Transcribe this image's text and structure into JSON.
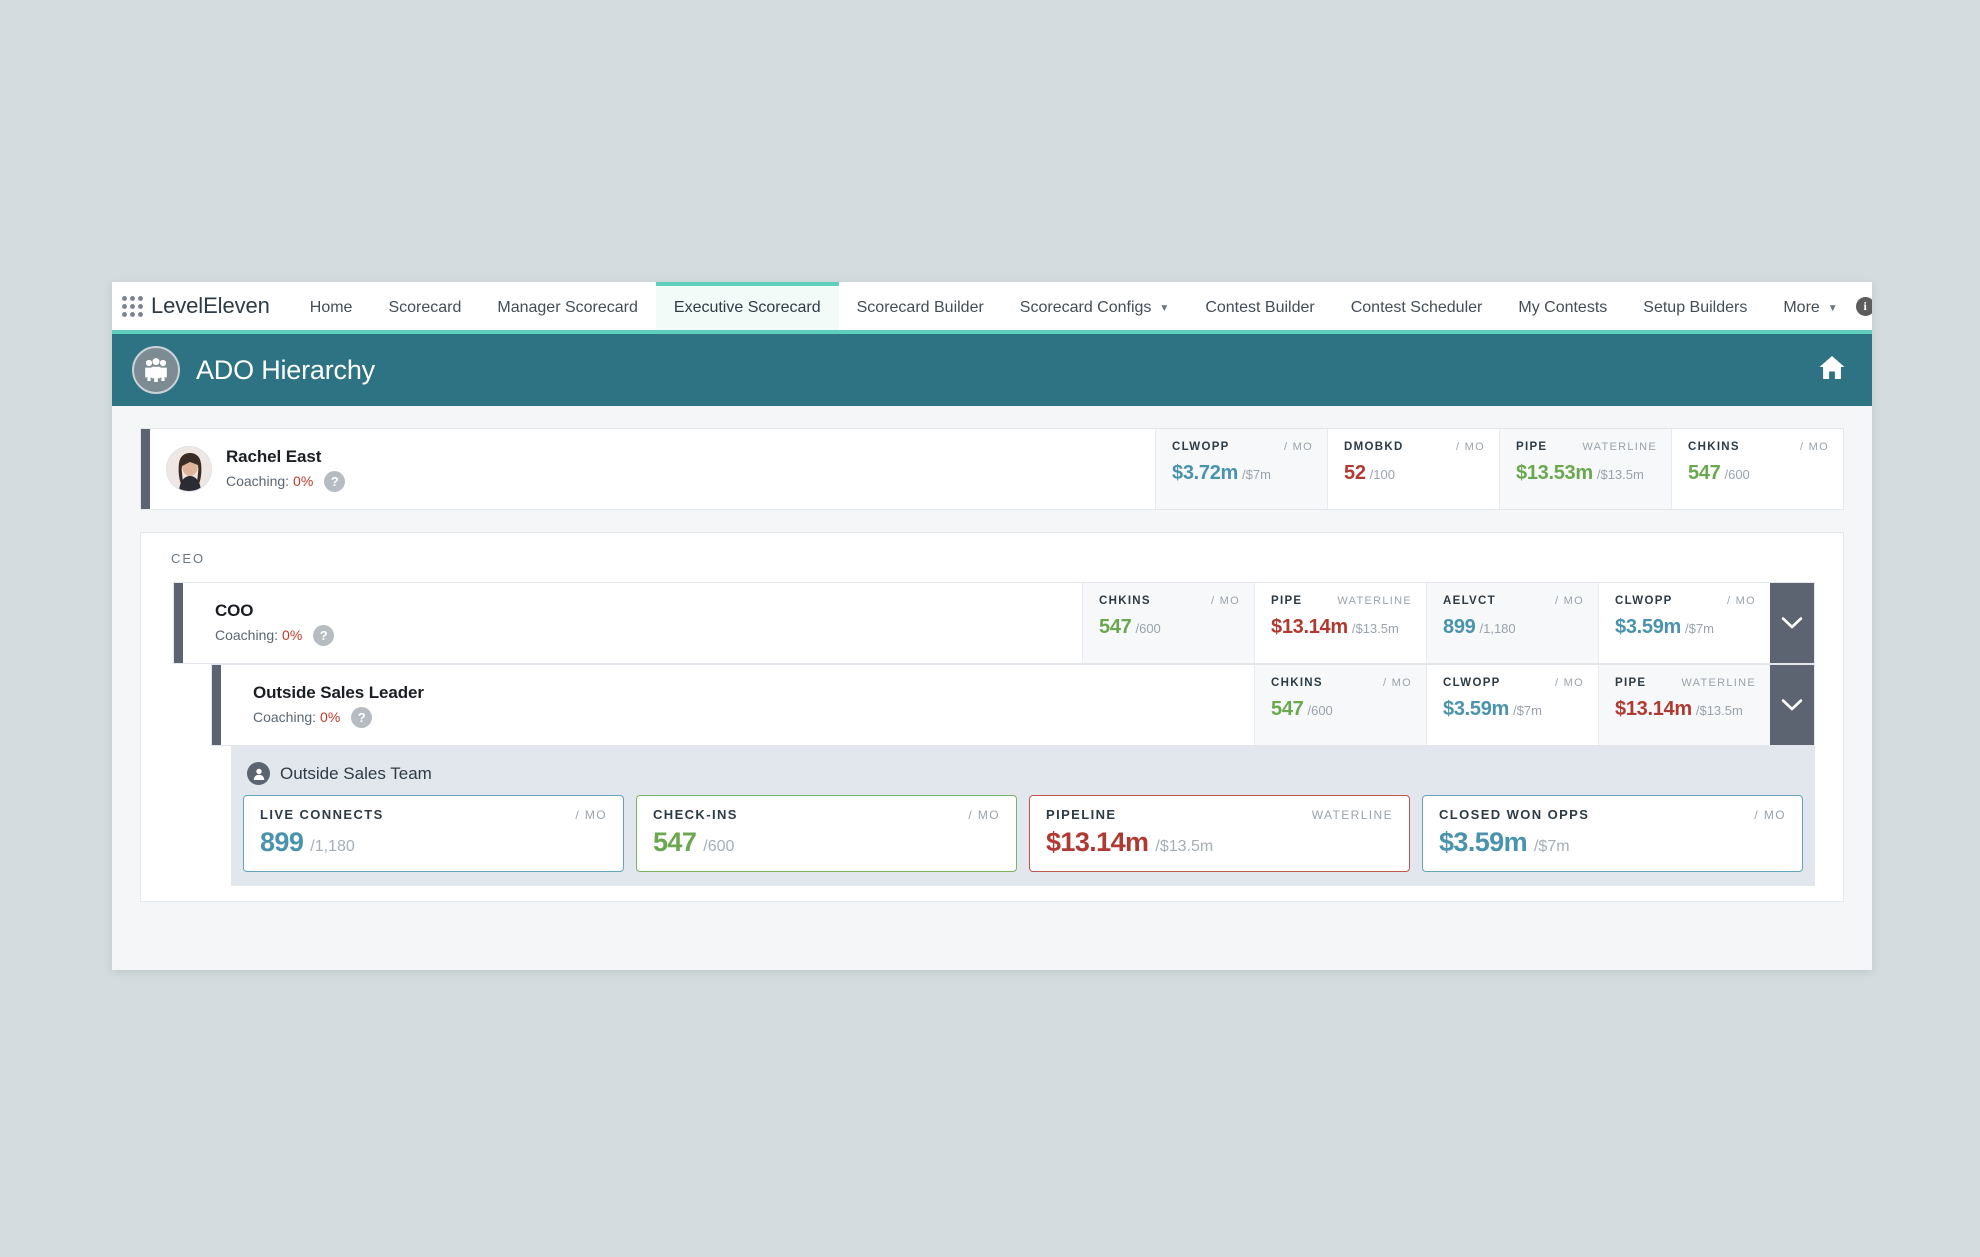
{
  "nav": {
    "brand": "LevelEleven",
    "waffle_icon": "app-launcher-grid-icon",
    "info_icon": "info-icon",
    "items": [
      {
        "label": "Home",
        "active": false,
        "caret": false
      },
      {
        "label": "Scorecard",
        "active": false,
        "caret": false
      },
      {
        "label": "Manager Scorecard",
        "active": false,
        "caret": false
      },
      {
        "label": "Executive Scorecard",
        "active": true,
        "caret": false
      },
      {
        "label": "Scorecard Builder",
        "active": false,
        "caret": false
      },
      {
        "label": "Scorecard Configs",
        "active": false,
        "caret": true
      },
      {
        "label": "Contest Builder",
        "active": false,
        "caret": false
      },
      {
        "label": "Contest Scheduler",
        "active": false,
        "caret": false
      },
      {
        "label": "My Contests",
        "active": false,
        "caret": false
      },
      {
        "label": "Setup Builders",
        "active": false,
        "caret": false
      },
      {
        "label": "More",
        "active": false,
        "caret": true
      }
    ]
  },
  "header": {
    "title": "ADO Hierarchy",
    "avatar_icon": "people-group-icon",
    "home_icon": "home-icon",
    "bg_color": "#2d7383",
    "accent_color": "#5ecfbd"
  },
  "exec": {
    "name": "Rachel East",
    "coaching_label": "Coaching:",
    "coaching_value": "0%",
    "help_glyph": "?",
    "metrics": [
      {
        "key": "CLWOPP",
        "unit": "/ MO",
        "value": "$3.72m",
        "goal": "/$7m",
        "color": "#4a93ad",
        "shaded": true
      },
      {
        "key": "DMOBKD",
        "unit": "/ MO",
        "value": "52",
        "goal": "/100",
        "color": "#b03a32",
        "shaded": false
      },
      {
        "key": "PIPE",
        "unit": "WATERLINE",
        "value": "$13.53m",
        "goal": "/$13.5m",
        "color": "#6aa84f",
        "shaded": true
      },
      {
        "key": "CHKINS",
        "unit": "/ MO",
        "value": "547",
        "goal": "/600",
        "color": "#6aa84f",
        "shaded": false
      }
    ]
  },
  "tree": {
    "section_label": "CEO",
    "nodes": [
      {
        "name": "COO",
        "coaching_label": "Coaching:",
        "coaching_value": "0%",
        "help_glyph": "?",
        "chevron_icon": "chevron-down-icon",
        "metrics": [
          {
            "key": "CHKINS",
            "unit": "/ MO",
            "value": "547",
            "goal": "/600",
            "color": "#6aa84f",
            "shaded": true
          },
          {
            "key": "PIPE",
            "unit": "WATERLINE",
            "value": "$13.14m",
            "goal": "/$13.5m",
            "color": "#b03a32",
            "shaded": false
          },
          {
            "key": "AELVCT",
            "unit": "/ MO",
            "value": "899",
            "goal": "/1,180",
            "color": "#4a93ad",
            "shaded": true
          },
          {
            "key": "CLWOPP",
            "unit": "/ MO",
            "value": "$3.59m",
            "goal": "/$7m",
            "color": "#4a93ad",
            "shaded": false
          }
        ]
      },
      {
        "name": "Outside Sales Leader",
        "coaching_label": "Coaching:",
        "coaching_value": "0%",
        "help_glyph": "?",
        "chevron_icon": "chevron-down-icon",
        "metrics": [
          {
            "key": "CHKINS",
            "unit": "/ MO",
            "value": "547",
            "goal": "/600",
            "color": "#6aa84f",
            "shaded": true
          },
          {
            "key": "CLWOPP",
            "unit": "/ MO",
            "value": "$3.59m",
            "goal": "/$7m",
            "color": "#4a93ad",
            "shaded": false
          },
          {
            "key": "PIPE",
            "unit": "WATERLINE",
            "value": "$13.14m",
            "goal": "/$13.5m",
            "color": "#b03a32",
            "shaded": true
          }
        ]
      }
    ]
  },
  "team": {
    "name": "Outside Sales Team",
    "icon": "user-avatar-icon",
    "cards": [
      {
        "key": "LIVE CONNECTS",
        "unit": "/ MO",
        "value": "899",
        "goal": "/1,180",
        "color": "#4a93ad",
        "border": "#62a5bc"
      },
      {
        "key": "CHECK-INS",
        "unit": "/ MO",
        "value": "547",
        "goal": "/600",
        "color": "#6aa84f",
        "border": "#7cb35e"
      },
      {
        "key": "PIPELINE",
        "unit": "WATERLINE",
        "value": "$13.14m",
        "goal": "/$13.5m",
        "color": "#b03a32",
        "border": "#c0564c"
      },
      {
        "key": "CLOSED WON OPPS",
        "unit": "/ MO",
        "value": "$3.59m",
        "goal": "/$7m",
        "color": "#4a93ad",
        "border": "#62a5bc"
      }
    ]
  }
}
